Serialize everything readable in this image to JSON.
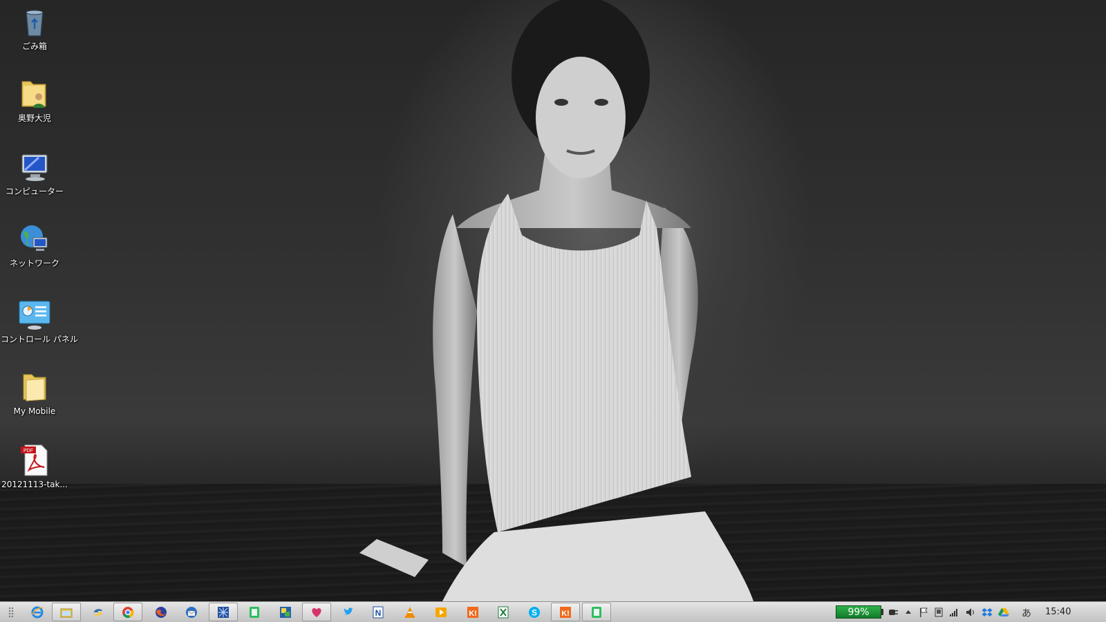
{
  "desktop": {
    "icons": [
      {
        "label": "ごみ箱",
        "icon": "recycle-bin-icon"
      },
      {
        "label": "奥野大児",
        "icon": "user-folder-icon"
      },
      {
        "label": "コンピューター",
        "icon": "computer-icon"
      },
      {
        "label": "ネットワーク",
        "icon": "network-icon"
      },
      {
        "label": "コントロール パネル",
        "icon": "control-panel-icon"
      },
      {
        "label": "My Mobile",
        "icon": "folder-icon"
      },
      {
        "label": "20121113-tak...",
        "icon": "pdf-file-icon"
      }
    ]
  },
  "taskbar": {
    "apps": [
      {
        "name": "internet-explorer",
        "open": false
      },
      {
        "name": "file-explorer",
        "open": true
      },
      {
        "name": "python",
        "open": false
      },
      {
        "name": "chrome",
        "open": true
      },
      {
        "name": "firefox",
        "open": false
      },
      {
        "name": "thunderbird",
        "open": false
      },
      {
        "name": "network-utility",
        "open": true
      },
      {
        "name": "evernote",
        "open": false
      },
      {
        "name": "image-viewer",
        "open": false
      },
      {
        "name": "heart-app",
        "open": true
      },
      {
        "name": "twitter",
        "open": false
      },
      {
        "name": "notepad-n",
        "open": false
      },
      {
        "name": "vlc",
        "open": false
      },
      {
        "name": "media-player",
        "open": false
      },
      {
        "name": "kt-app",
        "open": false
      },
      {
        "name": "excel-like",
        "open": false
      },
      {
        "name": "skype",
        "open": false
      },
      {
        "name": "kt-app-2",
        "open": true
      },
      {
        "name": "evernote-2",
        "open": true
      }
    ],
    "battery": "99%",
    "ime": "あ",
    "clock": "15:40"
  },
  "colors": {
    "battery": "#2fb24a",
    "taskbar": "#d4d4d4"
  }
}
